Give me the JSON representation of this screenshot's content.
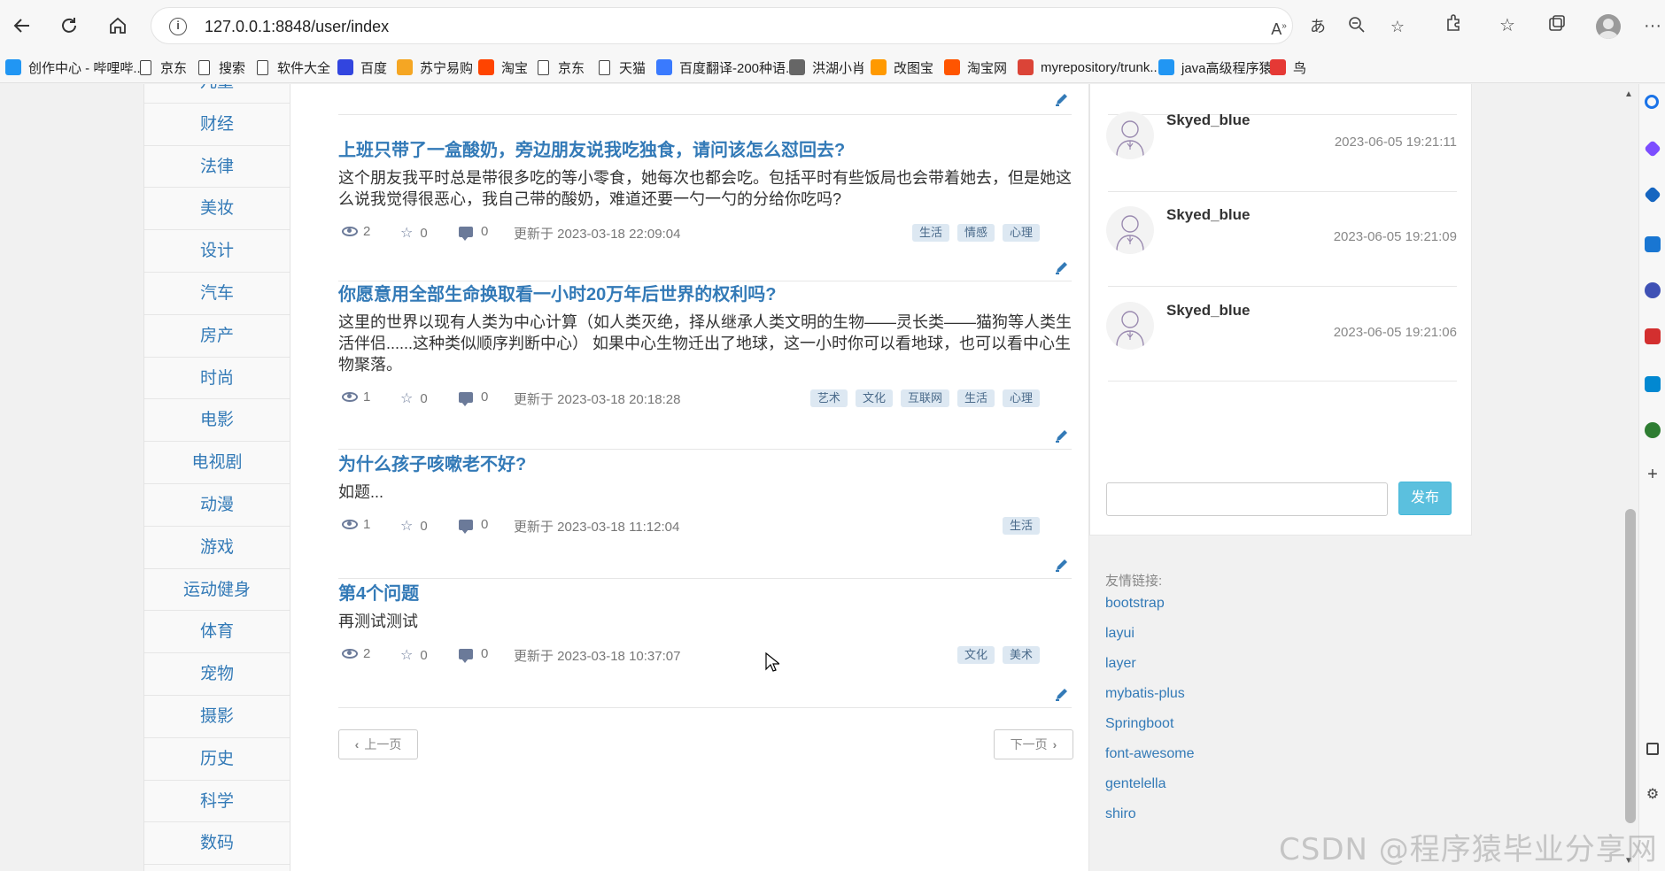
{
  "browser": {
    "url": "127.0.0.1:8848/user/index",
    "bookmarks": [
      {
        "label": "创作中心 - 哔哩哔...",
        "icon": "bilibili-icon",
        "color": "#2196f3"
      },
      {
        "label": "京东",
        "icon": "file-icon"
      },
      {
        "label": "搜索",
        "icon": "file-icon"
      },
      {
        "label": "软件大全",
        "icon": "file-icon"
      },
      {
        "label": "百度",
        "icon": "baidu-icon",
        "color": "#3245df"
      },
      {
        "label": "苏宁易购",
        "icon": "suning-icon",
        "color": "#f5a623"
      },
      {
        "label": "淘宝",
        "icon": "taobao-icon",
        "color": "#ff4400"
      },
      {
        "label": "京东",
        "icon": "file-icon"
      },
      {
        "label": "天猫",
        "icon": "file-icon"
      },
      {
        "label": "百度翻译-200种语...",
        "icon": "translate-icon",
        "color": "#3a7afe"
      },
      {
        "label": "洪湖小肖",
        "icon": "hhxx-icon",
        "color": "#666666"
      },
      {
        "label": "改图宝",
        "icon": "gaitubao-icon",
        "color": "#ff9900"
      },
      {
        "label": "淘宝网",
        "icon": "taobao-icon",
        "color": "#ff5500"
      },
      {
        "label": "myrepository/trunk...",
        "icon": "chrome-icon",
        "color": "#db4437"
      },
      {
        "label": "java高级程序猿",
        "icon": "bilibili-icon",
        "color": "#2196f3"
      },
      {
        "label": "鸟",
        "icon": "bird-icon",
        "color": "#e53935"
      }
    ]
  },
  "categories": [
    "儿童",
    "财经",
    "法律",
    "美妆",
    "设计",
    "汽车",
    "房产",
    "时尚",
    "电影",
    "电视剧",
    "动漫",
    "游戏",
    "运动健身",
    "体育",
    "宠物",
    "摄影",
    "历史",
    "科学",
    "数码"
  ],
  "questions": [
    {
      "title": "上班只带了一盒酸奶，旁边朋友说我吃独食，请问该怎么怼回去?",
      "body": "这个朋友我平时总是带很多吃的等小零食，她每次也都会吃。包括平时有些饭局也会带着她去，但是她这么说我觉得很恶心，我自己带的酸奶，难道还要一勺一勺的分给你吃吗?",
      "views": "2",
      "stars": "0",
      "comments": "0",
      "updated": "更新于 2023-03-18 22:09:04",
      "tags": [
        "生活",
        "情感",
        "心理"
      ]
    },
    {
      "title": "你愿意用全部生命换取看一小时20万年后世界的权利吗?",
      "body": "这里的世界以现有人类为中心计算（如人类灭绝，择从继承人类文明的生物——灵长类——猫狗等人类生活伴侣......这种类似顺序判断中心） 如果中心生物迁出了地球，这一小时你可以看地球，也可以看中心生物聚落。",
      "views": "1",
      "stars": "0",
      "comments": "0",
      "updated": "更新于 2023-03-18 20:18:28",
      "tags": [
        "艺术",
        "文化",
        "互联网",
        "生活",
        "心理"
      ]
    },
    {
      "title": "为什么孩子咳嗽老不好?",
      "body": "如题...",
      "views": "1",
      "stars": "0",
      "comments": "0",
      "updated": "更新于 2023-03-18 11:12:04",
      "tags": [
        "生活"
      ]
    },
    {
      "title": "第4个问题",
      "body": "再测试测试",
      "views": "2",
      "stars": "0",
      "comments": "0",
      "updated": "更新于 2023-03-18 10:37:07",
      "tags": [
        "文化",
        "美术"
      ]
    }
  ],
  "pager": {
    "prev": "上一页",
    "next": "下一页"
  },
  "messages": [
    {
      "name": "Skyed_blue",
      "time": "2023-06-05 19:21:11"
    },
    {
      "name": "Skyed_blue",
      "time": "2023-06-05 19:21:09"
    },
    {
      "name": "Skyed_blue",
      "time": "2023-06-05 19:21:06"
    }
  ],
  "chat": {
    "send_label": "发布"
  },
  "links": {
    "title": "友情链接:",
    "items": [
      "bootstrap",
      "layui",
      "layer",
      "mybatis-plus",
      "Springboot",
      "font-awesome",
      "gentelella",
      "shiro"
    ]
  },
  "watermark": "CSDN @程序猿毕业分享网"
}
